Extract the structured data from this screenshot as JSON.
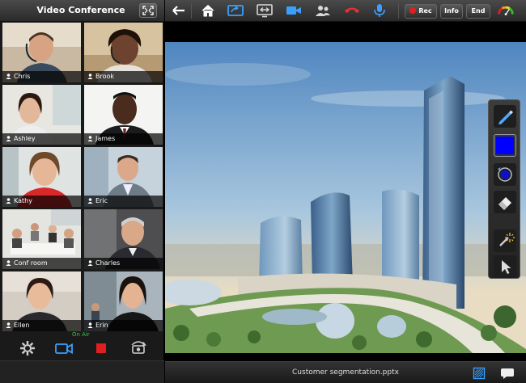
{
  "left_panel": {
    "title": "Video Conference",
    "expand_icon": "fullscreen-icon",
    "participants": [
      {
        "name": "Chris"
      },
      {
        "name": "Brook"
      },
      {
        "name": "Ashley"
      },
      {
        "name": "James"
      },
      {
        "name": "Kathy"
      },
      {
        "name": "Eric"
      },
      {
        "name": "Conf room"
      },
      {
        "name": "Charles"
      },
      {
        "name": "Ellen"
      },
      {
        "name": "Erin"
      }
    ],
    "on_air_label": "On Air",
    "bottom_icons": [
      "settings-icon",
      "video-camera-icon",
      "stop-icon",
      "switch-camera-icon"
    ]
  },
  "toolbar": {
    "icons": [
      "back-arrow-icon",
      "home-icon",
      "share-screen-icon",
      "switch-view-icon",
      "camera-icon",
      "participants-icon",
      "hang-up-icon",
      "microphone-icon"
    ],
    "rec_label": "Rec",
    "info_label": "Info",
    "end_label": "End",
    "signal_icon": "signal-gauge-icon",
    "active_color": "#3aa0ff",
    "rec_color": "#e02020"
  },
  "tools": {
    "items": [
      "pen-icon",
      "color-swatch",
      "brush-size-icon",
      "eraser-icon",
      "laser-pointer-icon",
      "pointer-icon"
    ],
    "selected_color": "#0000ff"
  },
  "bottom_bar": {
    "filename": "Customer segmentation.pptx",
    "icons": [
      "annotate-icon",
      "chat-icon"
    ]
  }
}
